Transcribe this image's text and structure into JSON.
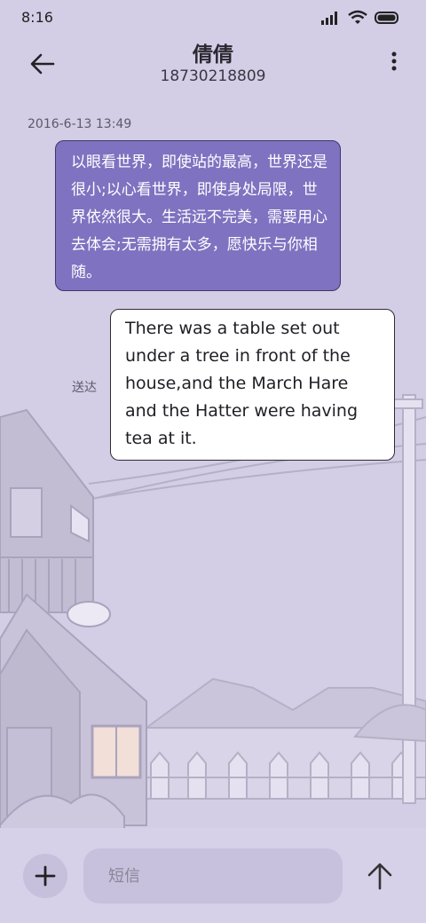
{
  "status_bar": {
    "time": "8:16"
  },
  "header": {
    "name": "倩倩",
    "number": "18730218809"
  },
  "conversation": {
    "timestamp": "2016-6-13 13:49",
    "incoming_text": "以眼看世界，即使站的最高，世界还是很小;以心看世界，即使身处局限，世界依然很大。生活远不完美，需要用心去体会;无需拥有太多，愿快乐与你相随。",
    "outgoing_text": "There was a table set out under a tree in front of the house,and the March Hare and the Hatter were having tea at it.",
    "delivered_label": "送达"
  },
  "composer": {
    "placeholder": "短信"
  },
  "colors": {
    "background": "#d3cde6",
    "incoming_bubble": "#7f72c0",
    "outgoing_bubble": "#ffffff"
  },
  "icons": [
    "signal-icon",
    "wifi-icon",
    "battery-icon",
    "back-arrow-icon",
    "more-vert-icon",
    "plus-icon",
    "send-arrow-icon"
  ]
}
